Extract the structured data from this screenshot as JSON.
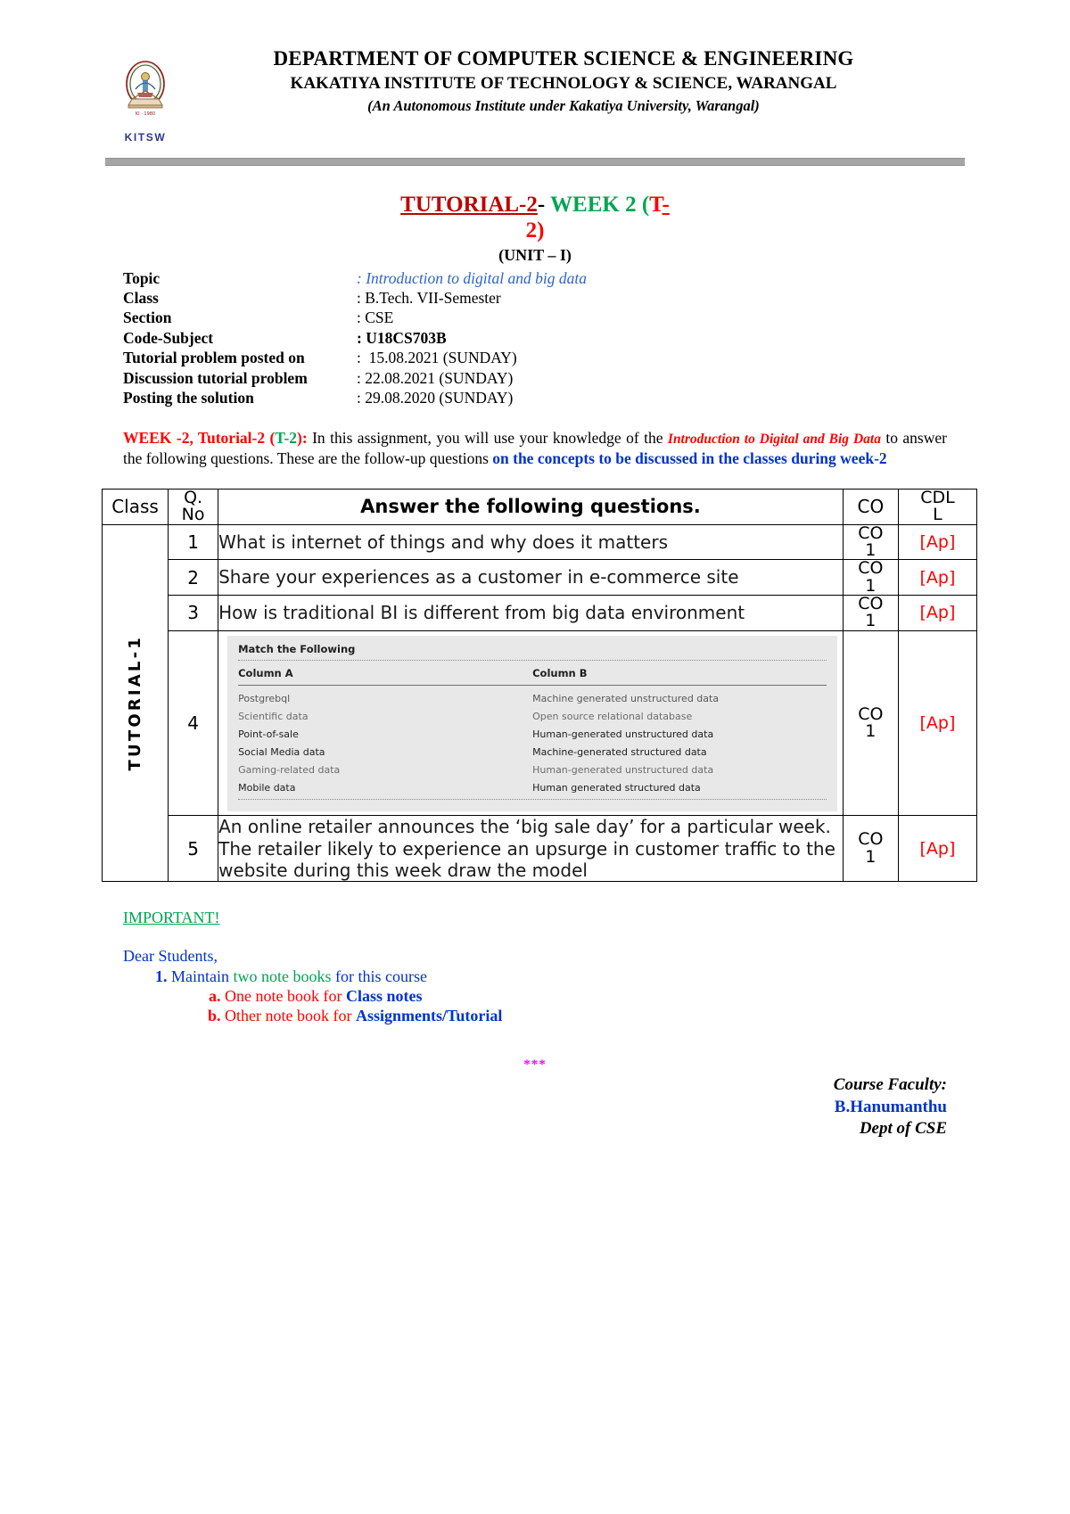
{
  "header": {
    "logo_caption": "KITSW",
    "department": "DEPARTMENT OF COMPUTER SCIENCE & ENGINEERING",
    "institute": "KAKATIYA INSTITUTE OF TECHNOLOGY & SCIENCE, WARANGAL",
    "autonomy_note": "(An Autonomous Institute under Kakatiya University, Warangal)"
  },
  "title": {
    "tutorial": "TUTORIAL-2",
    "dash": "-",
    "week": " WEEK 2 (",
    "t_prefix": "T",
    "t_suffix": "-",
    "line2": "2)",
    "unit": "(UNIT – I)"
  },
  "meta": [
    {
      "key": "Topic",
      "sep": ":",
      "value": "Introduction to digital and big data",
      "style": "blue"
    },
    {
      "key": "Class",
      "sep": ":",
      "value": "B.Tech. VII-Semester",
      "style": "plain"
    },
    {
      "key": "Section",
      "sep": ":",
      "value": "CSE",
      "style": "plain"
    },
    {
      "key": "Code-Subject",
      "sep": ":",
      "value": "U18CS703B",
      "style": "bold"
    },
    {
      "key": "Tutorial problem posted on",
      "sep": ":",
      "value": " 15.08.2021 (SUNDAY)",
      "style": "plain"
    },
    {
      "key": "Discussion tutorial problem",
      "sep": ":",
      "value": "22.08.2021 (SUNDAY)",
      "style": "plain"
    },
    {
      "key": "Posting the solution",
      "sep": ":",
      "value": "29.08.2020 (SUNDAY)",
      "style": "plain"
    }
  ],
  "intro": {
    "lead": "WEEK -2, Tutorial-2 (",
    "t2": "T-2",
    "lead_end": "):",
    "body1": " In this assignment, you will use your knowledge of the ",
    "ital1": "Introduction to Digital and Big Data",
    "body2": " to answer the following questions. These are the follow-up questions ",
    "blue1": "on the concepts to be discussed in the classes during week-2"
  },
  "table": {
    "headers": {
      "class": "Class",
      "qno_line1": "Q.",
      "qno_line2": "No",
      "question": "Answer the following questions.",
      "co": "CO",
      "cdl_line1": "CDL",
      "cdl_line2": "L"
    },
    "class_label": "TUTORIAL-1",
    "rows": [
      {
        "no": "1",
        "question": "What is internet of things and why does it matters",
        "co_line1": "CO",
        "co_line2": "1",
        "cdl": "[Ap]"
      },
      {
        "no": "2",
        "question": "Share your experiences as a customer in e-commerce site",
        "co_line1": "CO",
        "co_line2": "1",
        "cdl": "[Ap]"
      },
      {
        "no": "3",
        "question": "How is traditional BI is different from big data environment",
        "co_line1": "CO",
        "co_line2": "1",
        "cdl": "[Ap]"
      },
      {
        "no": "4",
        "question": "",
        "co_line1": "CO",
        "co_line2": "1",
        "cdl": "[Ap]"
      },
      {
        "no": "5",
        "question": "An online retailer announces the ‘big sale day’ for a particular week. The retailer likely to experience an upsurge in customer traffic to the website during this week draw the model",
        "co_line1": "CO",
        "co_line2": "1",
        "cdl": "[Ap]"
      }
    ]
  },
  "match_image": {
    "title": "Match the Following",
    "col_a_header": "Column A",
    "col_b_header": "Column B",
    "pairs": [
      {
        "a": "Postgrebql",
        "b": "Machine generated unstructured data"
      },
      {
        "a": "Scientific data",
        "b": "Open source relational database"
      },
      {
        "a": "Point-of-sale",
        "b": "Human-generated unstructured data"
      },
      {
        "a": "Social Media data",
        "b": "Machine-generated structured data"
      },
      {
        "a": "Gaming-related data",
        "b": "Human-generated unstructured data"
      },
      {
        "a": "Mobile data",
        "b": "Human generated structured data"
      }
    ]
  },
  "important": {
    "heading": "IMPORTANT!",
    "salutation": "Dear Students,",
    "item1_a": "Maintain ",
    "item1_green": "two note books",
    "item1_b": " for this course",
    "sub_a_red": "One note book for ",
    "sub_a_blue": "Class notes",
    "sub_b_red": "Other note book for ",
    "sub_b_blue": "Assignments/Tutorial",
    "stars": "***"
  },
  "footer": {
    "line1": "Course Faculty:",
    "line2": "B.Hanumanthu",
    "line3": "Dept of CSE"
  },
  "colors": {
    "red": "#ff0000",
    "dark_red": "#c00000",
    "green": "#00a651",
    "blue": "#0033cc",
    "topic_blue": "#2e64c8",
    "magenta": "#ff00ff"
  }
}
